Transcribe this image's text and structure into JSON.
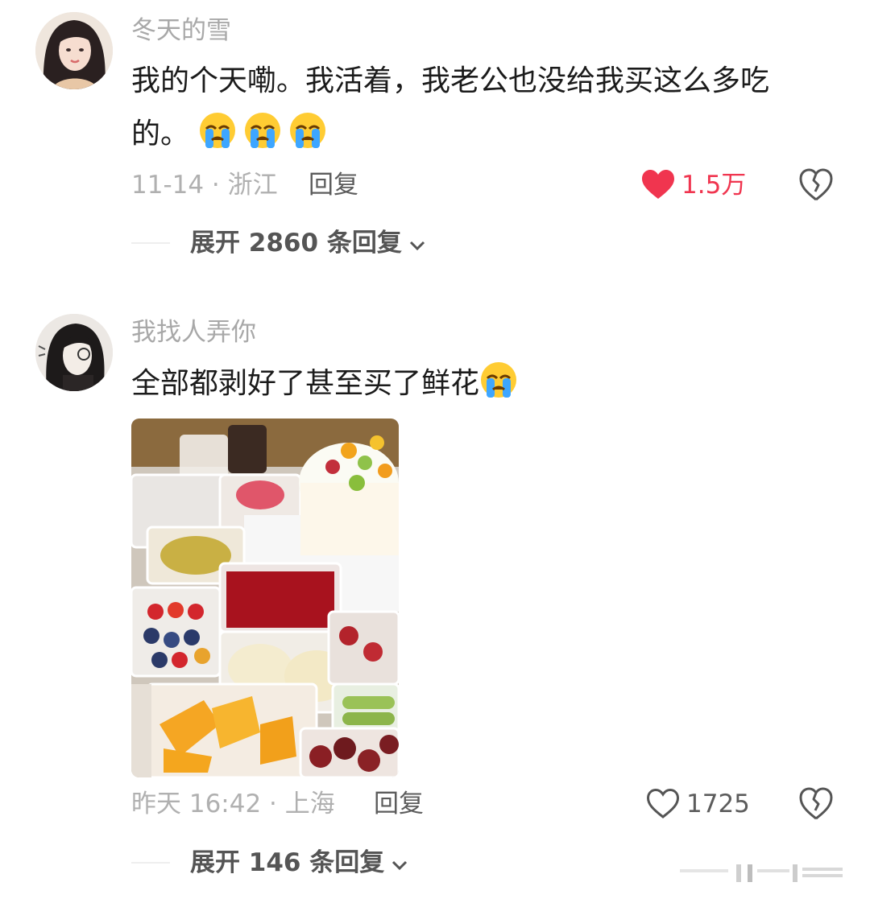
{
  "comments": [
    {
      "username": "冬天的雪",
      "text": "我的个天嘞。我活着，我老公也没给我买这么多吃的。",
      "text_line1": "我的个天嘞。我活着，我老公也没给我买这么多吃",
      "text_line2": "的。",
      "emoji_count": 3,
      "emoji": "crying-face",
      "date": "11-14",
      "location": "浙江",
      "meta": "11-14 · 浙江",
      "reply_label": "回复",
      "likes": "1.5万",
      "liked": true,
      "expand_label": "展开 2860 条回复"
    },
    {
      "username": "我找人弄你",
      "text": "全部都剥好了甚至买了鲜花",
      "emoji_count": 1,
      "emoji": "crying-face",
      "has_photo": true,
      "date": "昨天 16:42",
      "location": "上海",
      "meta": "昨天 16:42 · 上海",
      "reply_label": "回复",
      "likes": "1725",
      "liked": false,
      "expand_label": "展开 146 条回复"
    }
  ],
  "colors": {
    "like_active": "#f0354f",
    "muted": "#a8a8a8",
    "reply": "#5c5c5c"
  }
}
